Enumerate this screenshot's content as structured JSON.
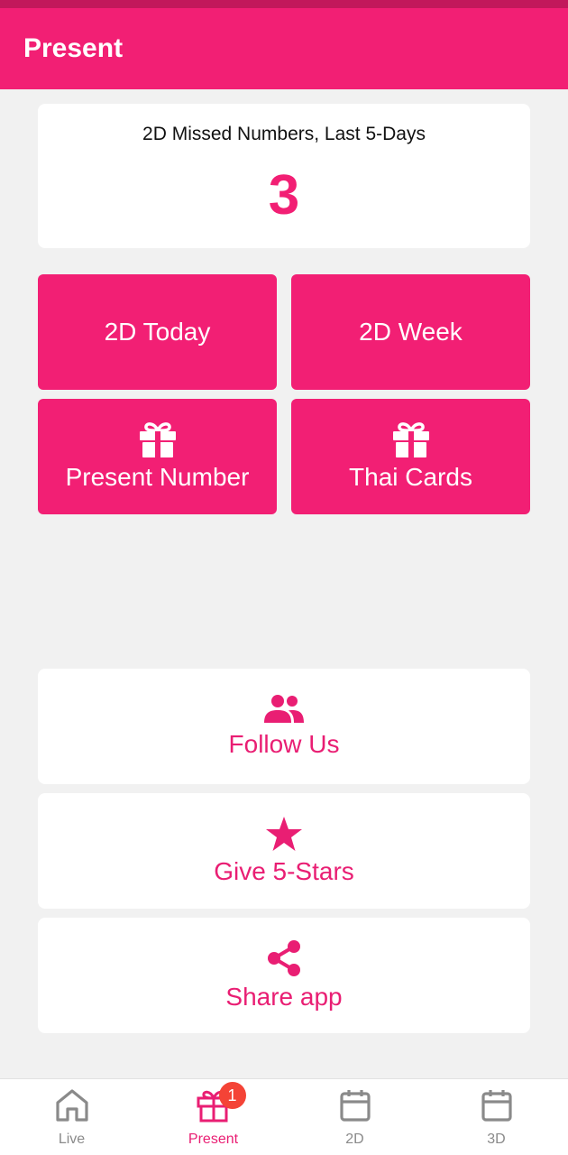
{
  "appbar": {
    "title": "Present"
  },
  "summary": {
    "label": "2D Missed Numbers, Last 5-Days",
    "value": "3"
  },
  "tiles": [
    {
      "label": "2D Today",
      "icon": ""
    },
    {
      "label": "2D Week",
      "icon": ""
    },
    {
      "label": "Present Number",
      "icon": "gift-icon"
    },
    {
      "label": "Thai Cards",
      "icon": "gift-icon"
    }
  ],
  "actions": [
    {
      "label": "Follow Us",
      "icon": "group-icon"
    },
    {
      "label": "Give 5-Stars",
      "icon": "star-icon"
    },
    {
      "label": "Share app",
      "icon": "share-icon"
    }
  ],
  "bottom_nav": {
    "items": [
      {
        "label": "Live",
        "icon": "home-icon"
      },
      {
        "label": "Present",
        "icon": "gift-icon",
        "badge": "1",
        "active": true
      },
      {
        "label": "2D",
        "icon": "calendar-icon"
      },
      {
        "label": "3D",
        "icon": "calendar-icon"
      }
    ]
  },
  "colors": {
    "primary": "#f21f74",
    "status_bar": "#c2185b",
    "background": "#f1f1f1",
    "badge": "#f44336",
    "inactive": "#8a8a8a"
  }
}
